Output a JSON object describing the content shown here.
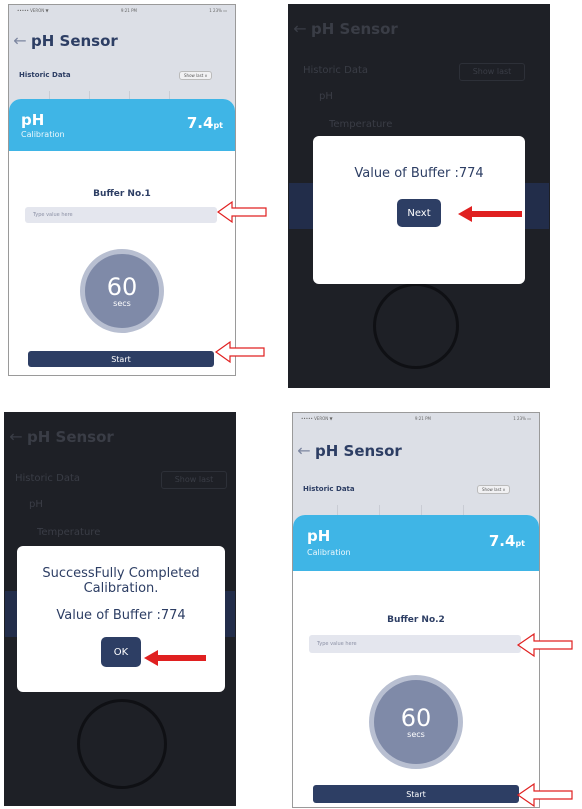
{
  "panel1": {
    "status_left": "••••• VERON ▼",
    "status_mid": "9:21 PM",
    "status_right": "1 23% ▭",
    "title": "pH Sensor",
    "historic": "Historic Data",
    "show_last": "Show last ∨",
    "sensor": "pH",
    "calibration": "Calibration",
    "value": "7.4",
    "unit": "pt",
    "buffer": "Buffer No.1",
    "placeholder": "Type value here",
    "timer_value": "60",
    "timer_unit": "secs",
    "start": "Start"
  },
  "panel2": {
    "title": "pH Sensor",
    "historic": "Historic Data",
    "show_last": "Show last",
    "dim1": "pH",
    "dim2": "Temperature",
    "message": "Value of Buffer :774",
    "next": "Next"
  },
  "panel3": {
    "title": "pH Sensor",
    "historic": "Historic Data",
    "show_last": "Show last",
    "dim1": "pH",
    "dim2": "Temperature",
    "line1": "SuccessFully Completed",
    "line2": "Calibration.",
    "line3": "Value of Buffer :774",
    "ok": "OK"
  },
  "panel4": {
    "status_left": "••••• VERON ▼",
    "status_mid": "9:21 PM",
    "status_right": "1 23% ▭",
    "title": "pH Sensor",
    "historic": "Historic Data",
    "show_last": "Show last ∨",
    "sensor": "pH",
    "calibration": "Calibration",
    "value": "7.4",
    "unit": "pt",
    "buffer": "Buffer No.2",
    "placeholder": "Type value here",
    "timer_value": "60",
    "timer_unit": "secs",
    "start": "Start"
  },
  "colors": {
    "accent_blue": "#3fb5e6",
    "navy": "#2d3e64",
    "annotation_red": "#e02020"
  }
}
